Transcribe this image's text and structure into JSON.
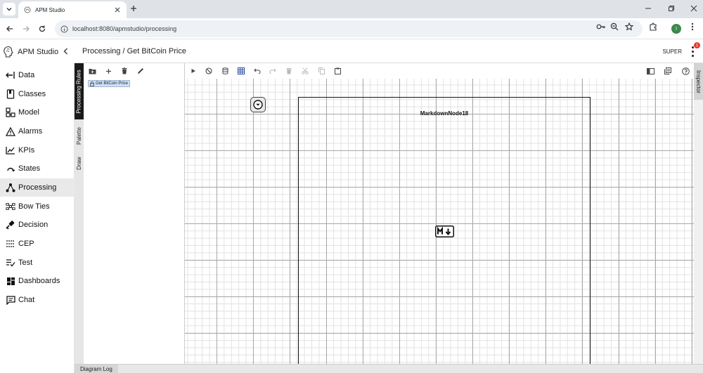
{
  "browser": {
    "tab_title": "APM Studio",
    "url": "localhost:8080/apmstudio/processing",
    "profile_initial": "I"
  },
  "app": {
    "brand": "APM Studio",
    "page_title": "Processing / Get BitCoin Price",
    "user": "SUPER",
    "notification_count": "1"
  },
  "sidebar": {
    "items": [
      {
        "label": "Data",
        "icon": "data-icon"
      },
      {
        "label": "Classes",
        "icon": "classes-icon"
      },
      {
        "label": "Model",
        "icon": "model-icon"
      },
      {
        "label": "Alarms",
        "icon": "alarm-icon"
      },
      {
        "label": "KPIs",
        "icon": "kpi-icon"
      },
      {
        "label": "States",
        "icon": "states-icon"
      },
      {
        "label": "Processing",
        "icon": "processing-icon",
        "active": true
      },
      {
        "label": "Bow Ties",
        "icon": "bowtie-icon"
      },
      {
        "label": "Decision",
        "icon": "decision-icon"
      },
      {
        "label": "CEP",
        "icon": "cep-icon"
      },
      {
        "label": "Test",
        "icon": "test-icon"
      },
      {
        "label": "Dashboards",
        "icon": "dashboard-icon"
      },
      {
        "label": "Chat",
        "icon": "chat-icon"
      }
    ]
  },
  "vertical_tabs": {
    "processing_rules": "Processing Rules",
    "palette": "Palette",
    "draw": "Draw"
  },
  "rules_panel": {
    "tree_item": "Get BitCoin Price"
  },
  "canvas": {
    "markdown_node_title": "MarkdownNode18"
  },
  "inspector": {
    "label": "Inspector"
  },
  "bottom": {
    "diagram_log": "Diagram Log"
  },
  "colors": {
    "active_tab": "#1a1a1a",
    "badge": "#e53935",
    "selection": "#cfe0f3"
  }
}
